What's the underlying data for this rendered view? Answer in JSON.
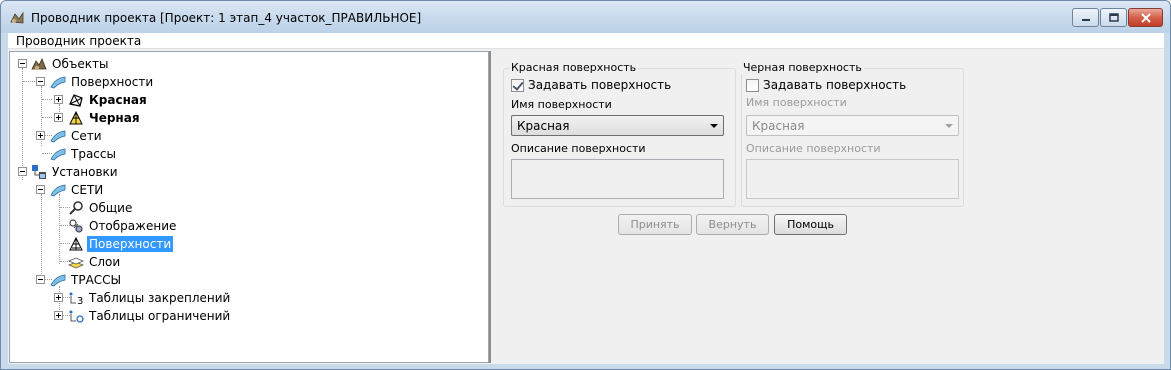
{
  "window": {
    "title": "Проводник проекта [Проект: 1 этап_4 участок_ПРАВИЛЬНОЕ]",
    "controls": {
      "minimize": "minimize",
      "restore": "restore",
      "close": "close"
    }
  },
  "menu": {
    "items": [
      {
        "label": "Проводник проекта"
      }
    ]
  },
  "tree": {
    "nodes": [
      {
        "label": "Объекты",
        "icon": "objects-icon"
      },
      {
        "label": "Поверхности",
        "icon": "surfaces-icon"
      },
      {
        "label": "Красная",
        "icon": "red-surface-icon",
        "bold": true
      },
      {
        "label": "Черная",
        "icon": "black-surface-icon",
        "bold": true
      },
      {
        "label": "Сети",
        "icon": "networks-icon"
      },
      {
        "label": "Трассы",
        "icon": "routes-icon"
      },
      {
        "label": "Установки",
        "icon": "settings-icon"
      },
      {
        "label": "СЕТИ",
        "icon": "networks-settings-icon"
      },
      {
        "label": "Общие",
        "icon": "general-icon"
      },
      {
        "label": "Отображение",
        "icon": "display-icon"
      },
      {
        "label": "Поверхности",
        "icon": "surface-settings-icon",
        "selected": true
      },
      {
        "label": "Слои",
        "icon": "layers-icon"
      },
      {
        "label": "ТРАССЫ",
        "icon": "routes-settings-icon"
      },
      {
        "label": "Таблицы закреплений",
        "icon": "fixation-tables-icon"
      },
      {
        "label": "Таблицы ограничений",
        "icon": "restriction-tables-icon"
      }
    ]
  },
  "red_surface": {
    "group_title": "Красная поверхность",
    "checkbox_label": "Задавать поверхность",
    "checked": true,
    "name_label": "Имя поверхности",
    "name_value": "Красная",
    "desc_label": "Описание поверхности",
    "desc_value": ""
  },
  "black_surface": {
    "group_title": "Черная поверхность",
    "checkbox_label": "Задавать поверхность",
    "checked": false,
    "name_label": "Имя поверхности",
    "name_value": "Красная",
    "desc_label": "Описание поверхности",
    "desc_value": ""
  },
  "buttons": {
    "apply": "Принять",
    "revert": "Вернуть",
    "help": "Помощь"
  }
}
